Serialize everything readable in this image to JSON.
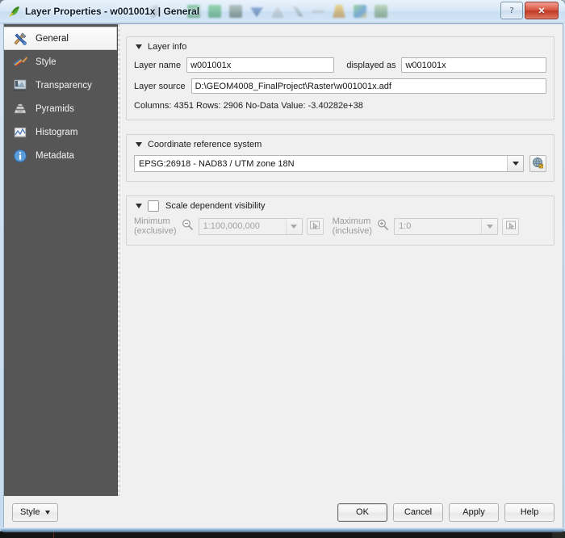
{
  "window": {
    "title": "Layer Properties - w001001x | General",
    "app_icon": "qgis-leaf-icon",
    "help_button": "?",
    "close_button": "✕"
  },
  "sidebar": {
    "items": [
      {
        "label": "General",
        "icon": "tools-icon",
        "active": true
      },
      {
        "label": "Style",
        "icon": "paintbrush-icon",
        "active": false
      },
      {
        "label": "Transparency",
        "icon": "transparency-icon",
        "active": false
      },
      {
        "label": "Pyramids",
        "icon": "pyramids-icon",
        "active": false
      },
      {
        "label": "Histogram",
        "icon": "histogram-icon",
        "active": false
      },
      {
        "label": "Metadata",
        "icon": "info-icon",
        "active": false
      }
    ]
  },
  "layer_info": {
    "group_title": "Layer info",
    "layer_name_label": "Layer name",
    "layer_name_value": "w001001x",
    "displayed_as_label": "displayed as",
    "displayed_as_value": "w001001x",
    "layer_source_label": "Layer source",
    "layer_source_value": "D:\\GEOM4008_FinalProject\\Raster\\w001001x.adf",
    "stats_line": "Columns: 4351  Rows: 2906  No-Data Value: -3.40282e+38"
  },
  "crs": {
    "group_title": "Coordinate reference system",
    "value": "EPSG:26918 - NAD83 / UTM zone  18N",
    "select_button_icon": "globe-crs-icon"
  },
  "scale_visibility": {
    "group_title": "Scale dependent visibility",
    "enabled": false,
    "minimum_label_line1": "Minimum",
    "minimum_label_line2": "(exclusive)",
    "minimum_icon": "zoom-out-icon",
    "minimum_value": "1:100,000,000",
    "minimum_pick_icon": "canvas-scale-icon",
    "maximum_label_line1": "Maximum",
    "maximum_label_line2": "(inclusive)",
    "maximum_icon": "zoom-in-icon",
    "maximum_value": "1:0",
    "maximum_pick_icon": "canvas-scale-icon"
  },
  "footer": {
    "style_button": "Style",
    "ok_button": "OK",
    "cancel_button": "Cancel",
    "apply_button": "Apply",
    "help_button": "Help"
  },
  "colors": {
    "sidebar_bg": "#565656",
    "panel_bg": "#f0f0f0",
    "titlebar_glass": "#d5e6f6",
    "close_red": "#c13a26",
    "qgis_green": "#3a8a3a"
  }
}
